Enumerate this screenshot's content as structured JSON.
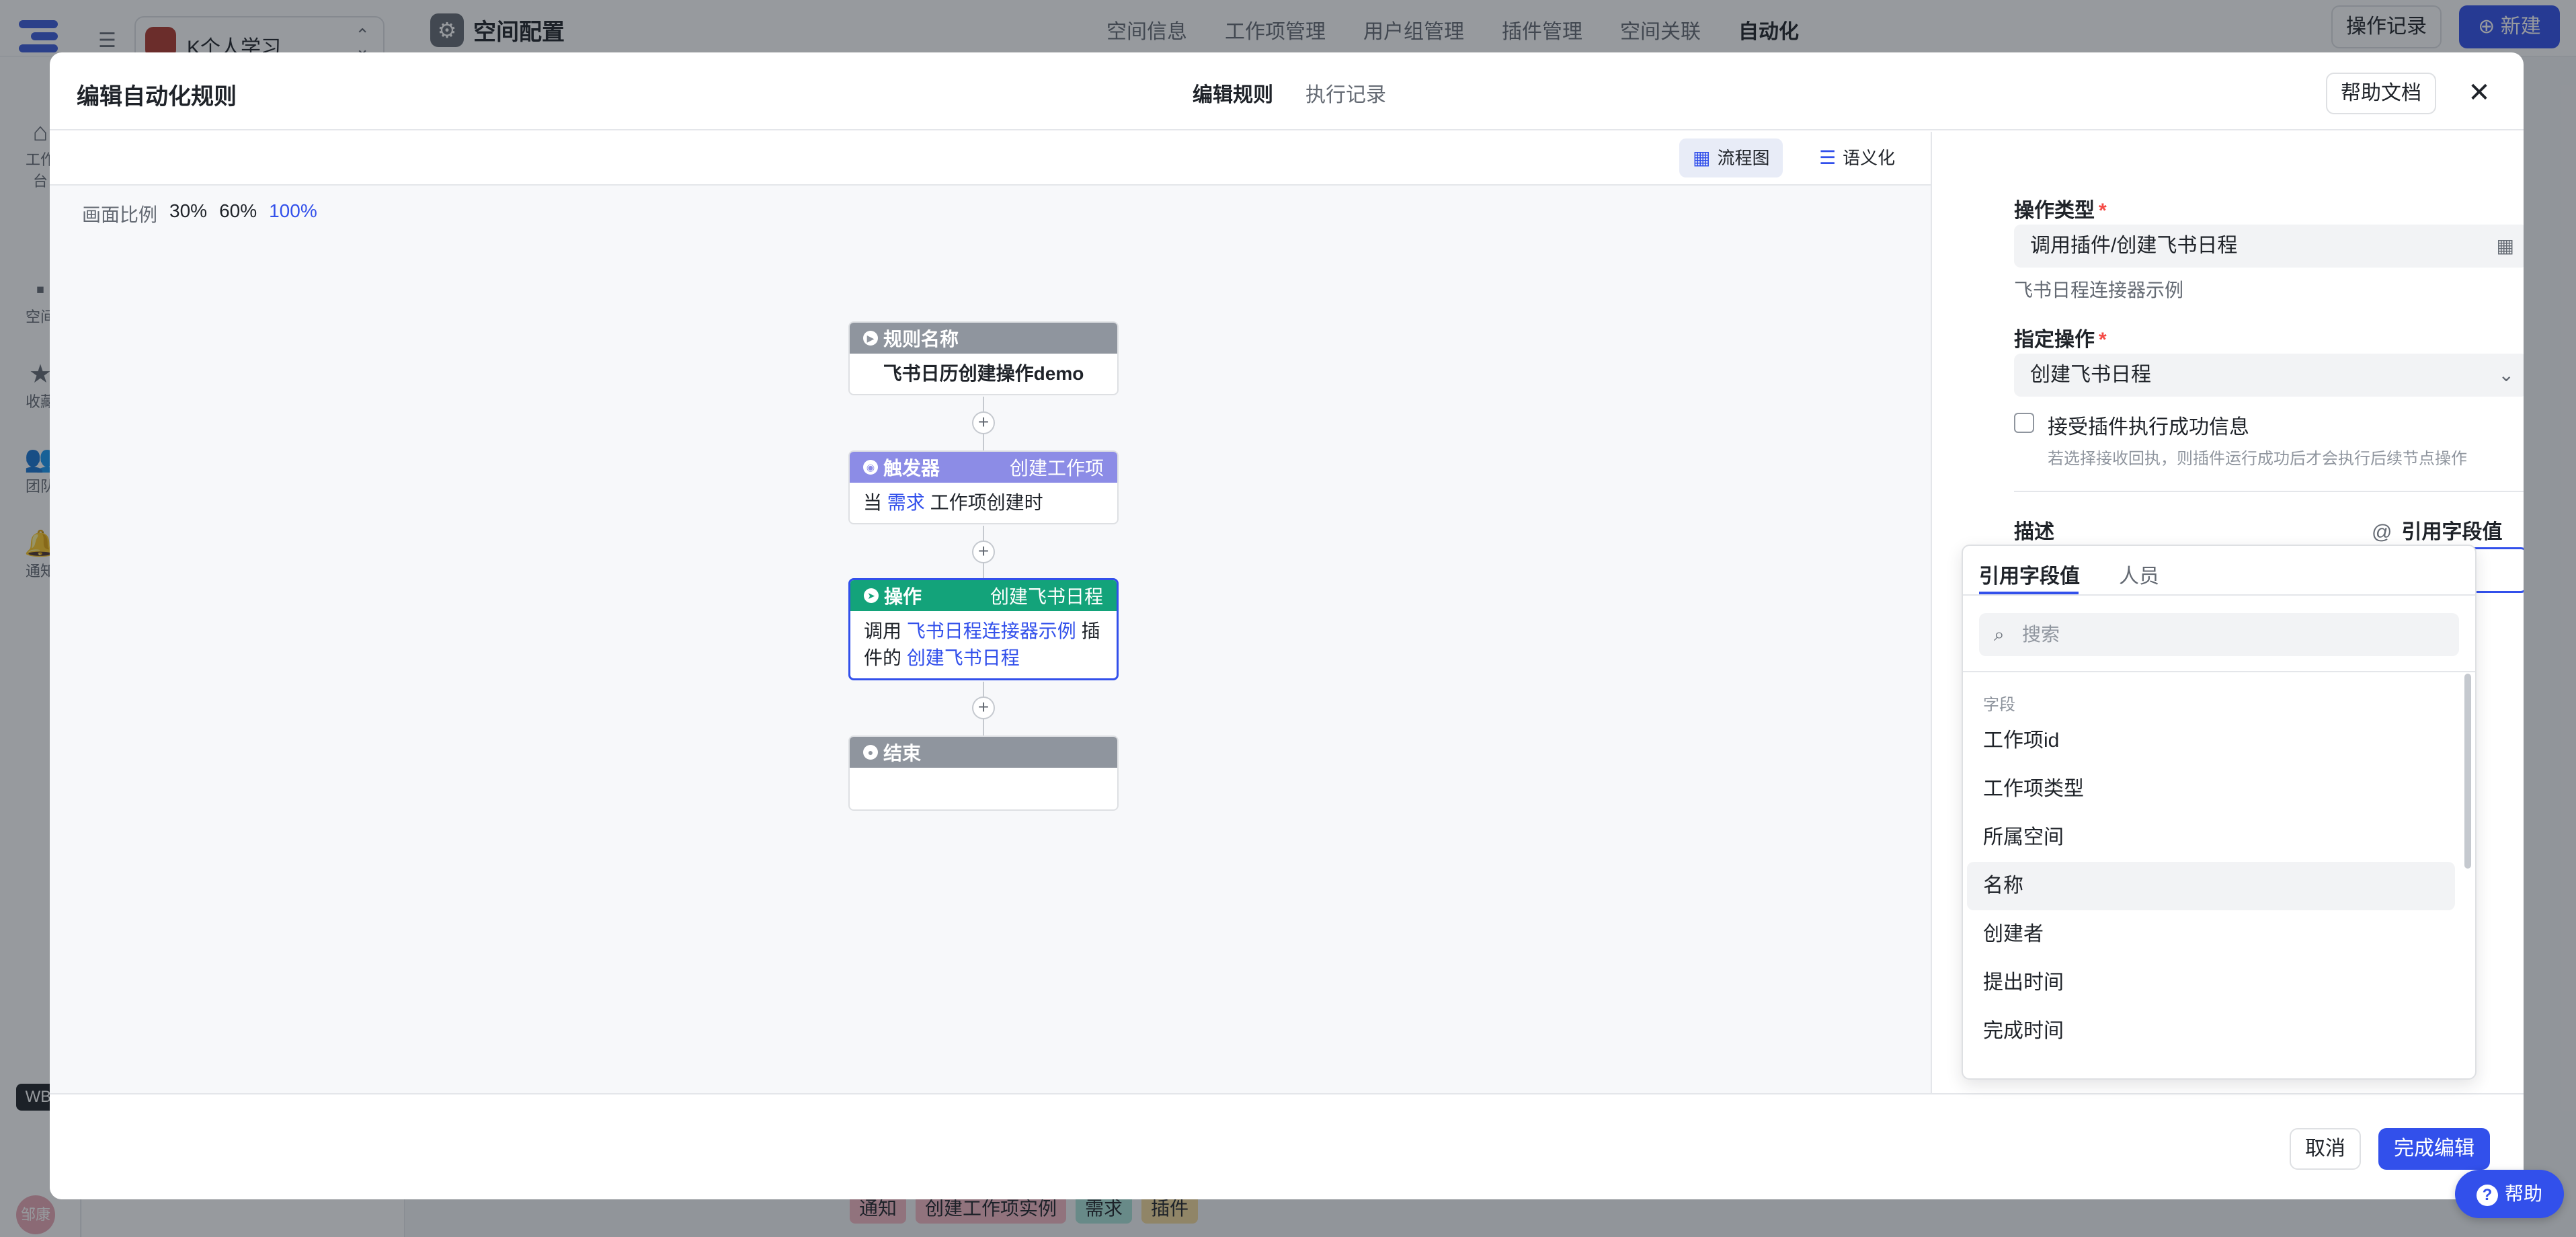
{
  "app": {
    "space_name": "K个人学习",
    "config_title": "空间配置",
    "nav": [
      "空间信息",
      "工作项管理",
      "用户组管理",
      "插件管理",
      "空间关联",
      "自动化"
    ],
    "active_nav": "自动化",
    "oplog_label": "操作记录",
    "new_label": "新建",
    "sidebar": [
      "工作台",
      "空间",
      "收藏",
      "团队",
      "通知"
    ],
    "wb_badge": "WB",
    "user_avatar": "邹康",
    "bg_tags": [
      "通知",
      "创建工作项实例",
      "需求",
      "插件"
    ],
    "help_label": "帮助"
  },
  "modal": {
    "title": "编辑自动化规则",
    "tabs": [
      "编辑规则",
      "执行记录"
    ],
    "active_tab": "编辑规则",
    "doc_label": "帮助文档"
  },
  "canvas": {
    "views": [
      {
        "label": "流程图",
        "icon": "flowchart-icon"
      },
      {
        "label": "语义化",
        "icon": "list-icon"
      }
    ],
    "zoom_label": "画面比例",
    "zoom_options": [
      "30%",
      "60%",
      "100%"
    ],
    "zoom_active": "100%",
    "nodes": {
      "rule": {
        "head": "规则名称",
        "body": "飞书日历创建操作demo"
      },
      "trigger": {
        "head": "触发器",
        "right": "创建工作项",
        "pre": "当",
        "link": "需求",
        "post": "工作项创建时"
      },
      "action": {
        "head": "操作",
        "right": "创建飞书日程",
        "pre": "调用",
        "link1": "飞书日程连接器示例",
        "mid": "插件的",
        "link2": "创建飞书日程"
      },
      "end": {
        "head": "结束"
      }
    }
  },
  "panel": {
    "op_type_label": "操作类型",
    "op_type_value": "调用插件/创建飞书日程",
    "op_type_sub": "飞书日程连接器示例",
    "op_label": "指定操作",
    "op_value": "创建飞书日程",
    "checkbox_label": "接受插件执行成功信息",
    "checkbox_hint": "若选择接收回执，则插件运行成功后才会执行后续节点操作",
    "desc_label": "描述",
    "desc_ref_label": "引用字段值",
    "desc_value": "@"
  },
  "popup": {
    "tabs": [
      "引用字段值",
      "人员"
    ],
    "active_tab": "引用字段值",
    "search_placeholder": "搜索",
    "group_label": "字段",
    "items": [
      "工作项id",
      "工作项类型",
      "所属空间",
      "名称",
      "创建者",
      "提出时间",
      "完成时间"
    ],
    "hover_item": "名称"
  },
  "footer": {
    "cancel_label": "取消",
    "done_label": "完成编辑"
  },
  "colors": {
    "accent": "#3250eb",
    "trigger": "#8c8ce6",
    "action": "#13a37a",
    "neutral": "#8f959e"
  }
}
